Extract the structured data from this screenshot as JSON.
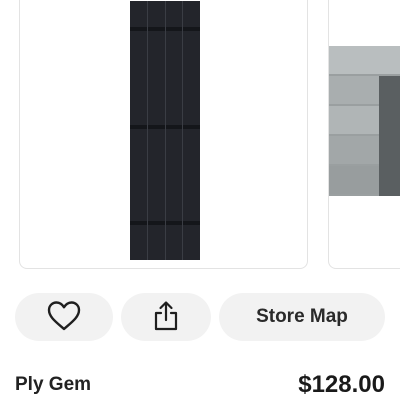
{
  "product_images": [
    {
      "name": "black-board-and-batten-shutter"
    },
    {
      "name": "gray-siding-house-wall"
    }
  ],
  "actions": {
    "favorite_icon": "heart-icon",
    "share_icon": "share-icon",
    "store_map_label": "Store Map"
  },
  "product": {
    "brand": "Ply Gem",
    "price": "$128.00"
  }
}
